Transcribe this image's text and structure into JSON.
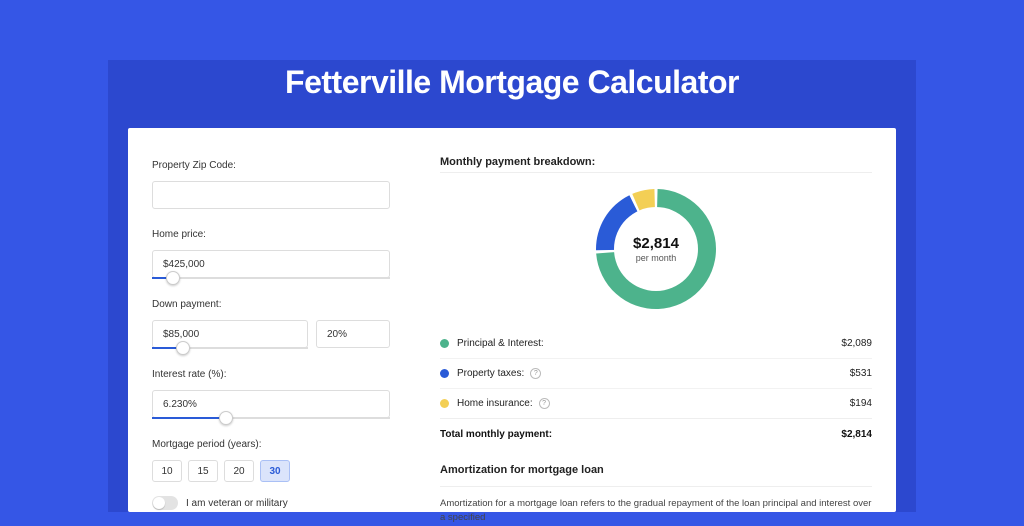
{
  "page": {
    "title": "Fetterville Mortgage Calculator"
  },
  "form": {
    "zip": {
      "label": "Property Zip Code:",
      "value": ""
    },
    "price": {
      "label": "Home price:",
      "value": "$425,000",
      "slider_pct": 9
    },
    "down": {
      "label": "Down payment:",
      "amount": "$85,000",
      "percent": "20%",
      "slider_pct": 20
    },
    "rate": {
      "label": "Interest rate (%):",
      "value": "6.230%",
      "slider_pct": 31
    },
    "period": {
      "label": "Mortgage period (years):",
      "options": [
        "10",
        "15",
        "20",
        "30"
      ],
      "selected": "30"
    },
    "veteran_label": "I am veteran or military"
  },
  "breakdown": {
    "title": "Monthly payment breakdown:",
    "center_amount": "$2,814",
    "center_sub": "per month",
    "items": [
      {
        "label": "Principal & Interest:",
        "value": "$2,089",
        "color": "#4db38c",
        "info": false
      },
      {
        "label": "Property taxes:",
        "value": "$531",
        "color": "#2a5bd7",
        "info": true
      },
      {
        "label": "Home insurance:",
        "value": "$194",
        "color": "#f3cf55",
        "info": true
      }
    ],
    "total_label": "Total monthly payment:",
    "total_value": "$2,814"
  },
  "amort": {
    "title": "Amortization for mortgage loan",
    "body": "Amortization for a mortgage loan refers to the gradual repayment of the loan principal and interest over a specified"
  },
  "chart_data": {
    "type": "pie",
    "title": "Monthly payment breakdown",
    "series": [
      {
        "name": "Principal & Interest",
        "value": 2089,
        "color": "#4db38c"
      },
      {
        "name": "Property taxes",
        "value": 531,
        "color": "#2a5bd7"
      },
      {
        "name": "Home insurance",
        "value": 194,
        "color": "#f3cf55"
      }
    ],
    "total": 2814,
    "center_label": "$2,814 per month"
  }
}
